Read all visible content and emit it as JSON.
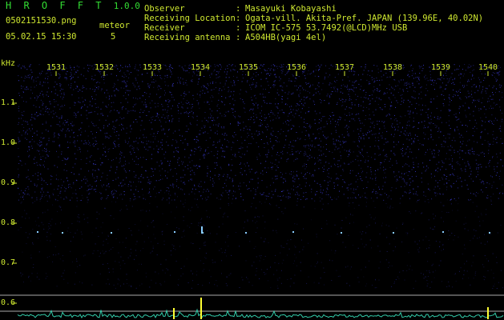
{
  "app": {
    "name": "H R O F F T",
    "version": "1.0.0"
  },
  "file": {
    "filename": "0502151530.png",
    "datetime": "05.02.15 15:30"
  },
  "meteor": {
    "label": "meteor",
    "count": "5"
  },
  "station": [
    {
      "key": "Observer",
      "sep": ":",
      "value": "Masayuki Kobayashi"
    },
    {
      "key": "Receiving Location",
      "sep": ":",
      "value": "Ogata-vill. Akita-Pref. JAPAN (139.96E, 40.02N)"
    },
    {
      "key": "Receiver",
      "sep": ":",
      "value": "ICOM IC-575 53.7492(@LCD)MHz USB"
    },
    {
      "key": "Receiving antenna",
      "sep": ":",
      "value": "A504HB(yagi 4el)"
    }
  ],
  "axes": {
    "y_unit": "kHz",
    "y_ticks": [
      "1.1",
      "1.0",
      "0.9",
      "0.8",
      "0.7",
      "0.6"
    ],
    "x_ticks": [
      "1531",
      "1532",
      "1533",
      "1534",
      "1535",
      "1536",
      "1537",
      "1538",
      "1539",
      "1540"
    ]
  },
  "colors": {
    "background": "#000000",
    "label": "#cfe830",
    "title": "#33dd33",
    "noise": "#3a3ad0",
    "echo": "#88ccff",
    "trace": "#33ccaa",
    "peak": "#ffff33",
    "tick": "#cfe830"
  }
}
